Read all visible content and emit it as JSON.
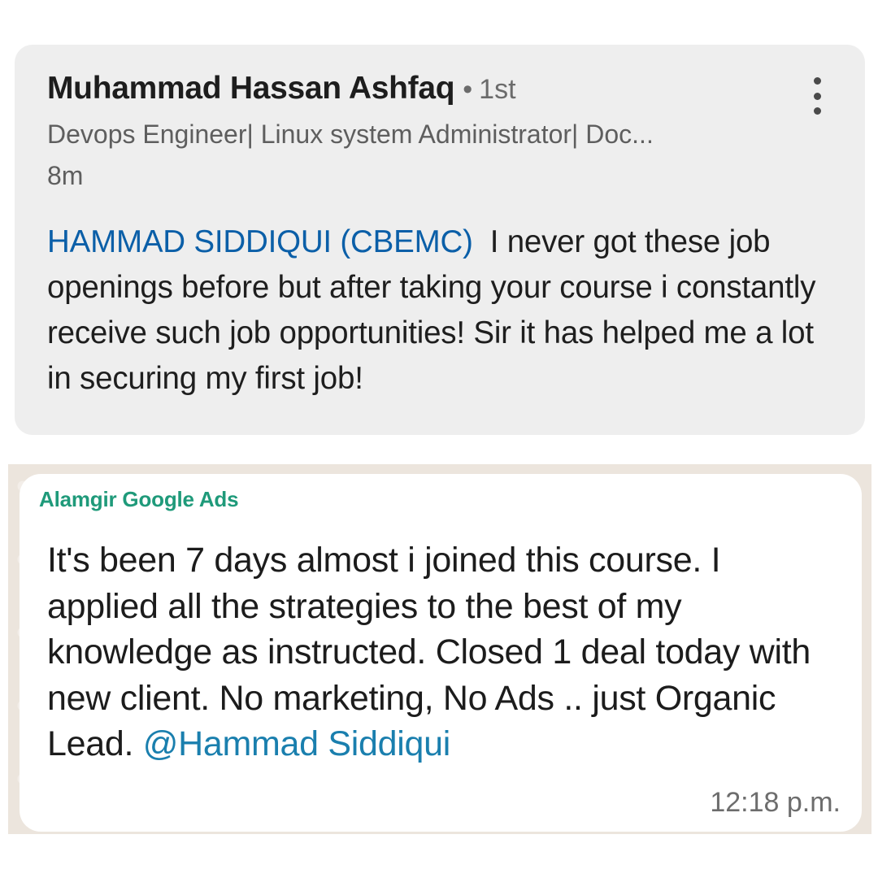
{
  "linkedin_comment": {
    "author_name": "Muhammad Hassan Ashfaq",
    "separator": "•",
    "connection_degree": "1st",
    "headline": "Devops Engineer| Linux system Administrator| Doc...",
    "time_ago": "8m",
    "more_icon": "three-dots-vertical-icon",
    "mention": "HAMMAD SIDDIQUI (CBEMC)",
    "text": "I never got these job openings before but after taking your course i constantly receive such job opportunities! Sir it has helped me a lot in securing my first job!",
    "mention_color": "#0b5fa8"
  },
  "whatsapp_message": {
    "sender": "Alamgir Google Ads",
    "text": "It's been 7 days almost i joined this course. I applied all the strategies to the best of my knowledge as instructed. Closed 1 deal today with new client. No marketing, No Ads .. just Organic Lead. ",
    "mention": "@Hammad Siddiqui",
    "time": "12:18 p.m.",
    "sender_color": "#1f9a7a",
    "mention_color": "#1a7fae"
  }
}
